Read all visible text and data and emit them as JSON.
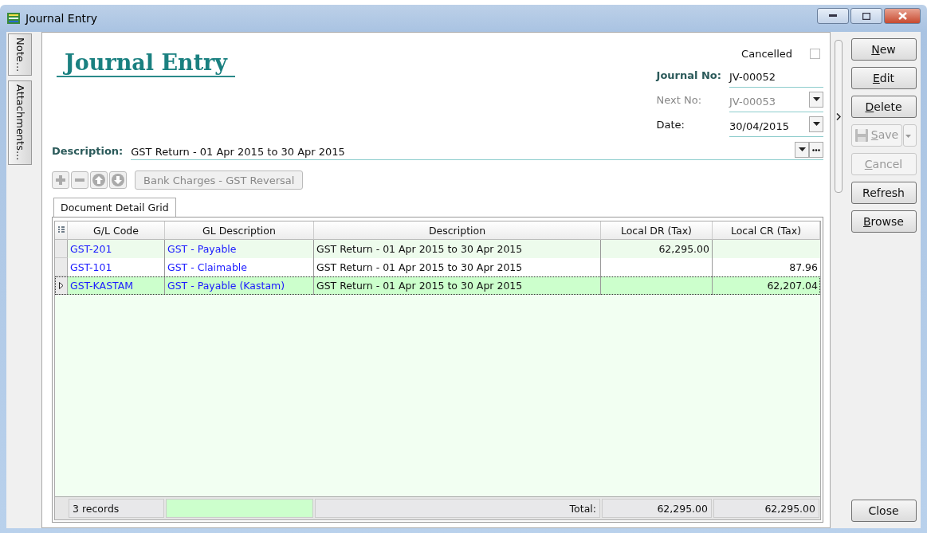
{
  "window": {
    "title": "Journal Entry"
  },
  "side_tabs": [
    {
      "label": "Note..."
    },
    {
      "label": "Attachments..."
    }
  ],
  "header": {
    "title": "Journal Entry",
    "cancelled": {
      "label": "Cancelled",
      "checked": false
    },
    "journal_no": {
      "label": "Journal No:",
      "value": "JV-00052"
    },
    "next_no": {
      "label": "Next No:",
      "value": "JV-00053",
      "disabled": true
    },
    "date": {
      "label": "Date:",
      "value": "30/04/2015"
    }
  },
  "description": {
    "label": "Description:",
    "value": "GST Return - 01 Apr 2015 to 30 Apr 2015"
  },
  "toolbar": {
    "template_button": "Bank Charges - GST Reversal"
  },
  "tabs": [
    {
      "label": "Document Detail Grid",
      "selected": true
    }
  ],
  "table": {
    "columns": [
      "G/L Code",
      "GL Description",
      "Description",
      "Local DR (Tax)",
      "Local CR (Tax)"
    ],
    "rows": [
      {
        "gl_code": "GST-201",
        "gl_description": "GST - Payable",
        "description": "GST Return - 01 Apr 2015 to 30 Apr 2015",
        "local_dr": "62,295.00",
        "local_cr": "",
        "selected": false
      },
      {
        "gl_code": "GST-101",
        "gl_description": "GST - Claimable",
        "description": "GST Return - 01 Apr 2015 to 30 Apr 2015",
        "local_dr": "",
        "local_cr": "87.96",
        "selected": false
      },
      {
        "gl_code": "GST-KASTAM",
        "gl_description": "GST - Payable (Kastam)",
        "description": "GST Return - 01 Apr 2015 to 30 Apr 2015",
        "local_dr": "",
        "local_cr": "62,207.04",
        "selected": true
      }
    ],
    "footer": {
      "count": "3 records",
      "total_label": "Total:",
      "total_dr": "62,295.00",
      "total_cr": "62,295.00"
    }
  },
  "buttons": [
    {
      "kind": "plain",
      "mnemonic": "N",
      "rest": "ew",
      "disabled": false
    },
    {
      "kind": "plain",
      "mnemonic": "E",
      "rest": "dit",
      "disabled": false
    },
    {
      "kind": "plain",
      "mnemonic": "D",
      "rest": "elete",
      "disabled": false
    },
    {
      "kind": "split",
      "mnemonic": "S",
      "rest": "ave",
      "disabled": true
    },
    {
      "kind": "plain",
      "mnemonic": "C",
      "rest": "ancel",
      "disabled": true
    },
    {
      "kind": "plain",
      "rest": "Refresh",
      "disabled": false
    },
    {
      "kind": "plain",
      "mnemonic": "B",
      "rest": "rowse",
      "disabled": false
    }
  ],
  "close_button": "Close"
}
